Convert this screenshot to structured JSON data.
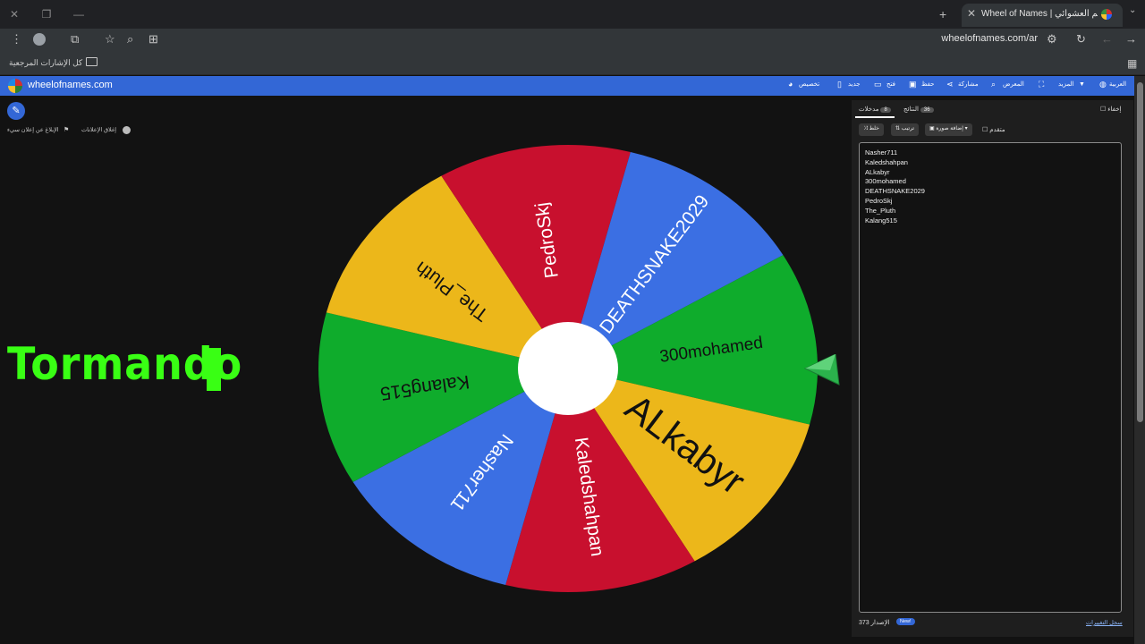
{
  "browser": {
    "tab_title": "Wheel of Names | اسم العشوائي",
    "url": "wheelofnames.com/ar",
    "bookmarks_label": "كل الإشارات المرجعية"
  },
  "site": {
    "name": "wheelofnames.com",
    "nav": {
      "language": "العربية",
      "more": "المزيد",
      "gallery": "المعرض",
      "share": "مشاركة",
      "save": "حفظ",
      "open": "فتح",
      "new": "جديد",
      "customize": "تخصيص"
    }
  },
  "left_links": {
    "close_ads": "إغلاق الإعلانات",
    "report_ad": "الإبلاغ عن إعلان سيء"
  },
  "overlay_text": "Tormando",
  "wheel": {
    "segments": [
      {
        "label": "300mohamed",
        "color": "#0fac2c"
      },
      {
        "label": "ALkabyr",
        "color": "#ecb71a"
      },
      {
        "label": "Kaledshahpan",
        "color": "#c8102e"
      },
      {
        "label": "Nasher711",
        "color": "#3b6fe3"
      },
      {
        "label": "Kalang515",
        "color": "#0fac2c"
      },
      {
        "label": "The_Pluth",
        "color": "#ecb71a"
      },
      {
        "label": "PedroSkj",
        "color": "#c8102e"
      },
      {
        "label": "DEATHSNAKE2029",
        "color": "#3b6fe3"
      }
    ]
  },
  "panel": {
    "tab_entries": "مدخلات",
    "tab_entries_count": "8",
    "tab_results": "النتائج",
    "tab_results_count": "36",
    "hide_label": "إخفاء",
    "shuffle": "خلط",
    "sort": "ترتيب",
    "add_image": "إضافة صورة",
    "advanced": "متقدم",
    "entries": [
      "Nasher711",
      "Kaledshahpan",
      "ALkabyr",
      "300mohamed",
      "DEATHSNAKE2029",
      "PedroSkj",
      "The_Pluth",
      "Kalang515"
    ],
    "version": "الإصدار 373",
    "new_badge": "New!",
    "changelog": "سجل التغييرات"
  },
  "colors": {
    "header_blue": "#3367d6",
    "overlay_green": "#39ff14",
    "pointer_green": "#2bb24c"
  }
}
